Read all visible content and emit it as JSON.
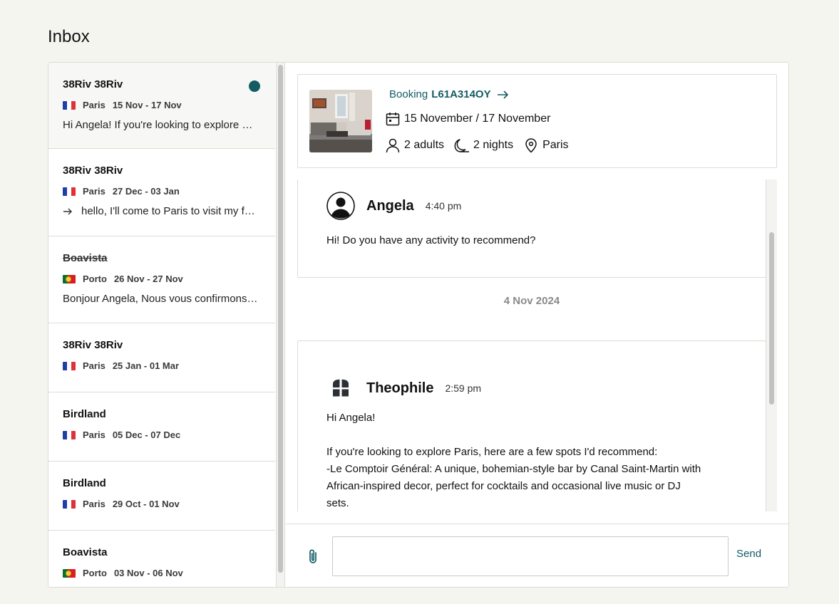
{
  "page": {
    "title": "Inbox"
  },
  "conversations": [
    {
      "name": "38Riv 38Riv",
      "location": "Paris",
      "flag": "fr",
      "dates": "15 Nov - 17 Nov",
      "preview": "Hi Angela! If you're looking to explore Paris, here are a few spots",
      "unread": true,
      "active": true,
      "struck": false,
      "outgoing": false
    },
    {
      "name": "38Riv 38Riv",
      "location": "Paris",
      "flag": "fr",
      "dates": "27 Dec - 03 Jan",
      "preview": "hello, I'll come to Paris to visit my family",
      "unread": false,
      "active": false,
      "struck": false,
      "outgoing": true
    },
    {
      "name": "Boavista",
      "location": "Porto",
      "flag": "pt",
      "dates": "26 Nov - 27 Nov",
      "preview": "Bonjour Angela, Nous vous confirmons votre réservation",
      "unread": false,
      "active": false,
      "struck": true,
      "outgoing": false
    },
    {
      "name": "38Riv 38Riv",
      "location": "Paris",
      "flag": "fr",
      "dates": "25 Jan - 01 Mar",
      "preview": "",
      "unread": false,
      "active": false,
      "struck": false,
      "outgoing": false
    },
    {
      "name": "Birdland",
      "location": "Paris",
      "flag": "fr",
      "dates": "05 Dec - 07 Dec",
      "preview": "",
      "unread": false,
      "active": false,
      "struck": false,
      "outgoing": false
    },
    {
      "name": "Birdland",
      "location": "Paris",
      "flag": "fr",
      "dates": "29 Oct - 01 Nov",
      "preview": "",
      "unread": false,
      "active": false,
      "struck": false,
      "outgoing": false
    },
    {
      "name": "Boavista",
      "location": "Porto",
      "flag": "pt",
      "dates": "03 Nov - 06 Nov",
      "preview": "",
      "unread": false,
      "active": false,
      "struck": false,
      "outgoing": false
    }
  ],
  "booking": {
    "label": "Booking",
    "code": "L61A314OY",
    "dates": "15 November / 17 November",
    "guests": "2 adults",
    "nights": "2 nights",
    "location": "Paris"
  },
  "thread": {
    "messages": [
      {
        "author": "Angela",
        "time": "4:40 pm",
        "body": "Hi! Do you have any activity to recommend?"
      },
      {
        "author": "Theophile",
        "time": "2:59 pm",
        "body_lines": [
          "Hi Angela!",
          "",
          "If you're looking to explore Paris, here are a few spots I'd recommend:",
          "-Le Comptoir Général: A unique, bohemian-style bar by Canal Saint-Martin with",
          "African-inspired decor, perfect for cocktails and occasional live music or DJ",
          "sets."
        ]
      }
    ],
    "date_separator": "4 Nov 2024"
  },
  "composer": {
    "placeholder": "",
    "send_label": "Send"
  },
  "colors": {
    "accent": "#135c63",
    "background": "#f5f5f0",
    "border": "#dcdcd6"
  }
}
